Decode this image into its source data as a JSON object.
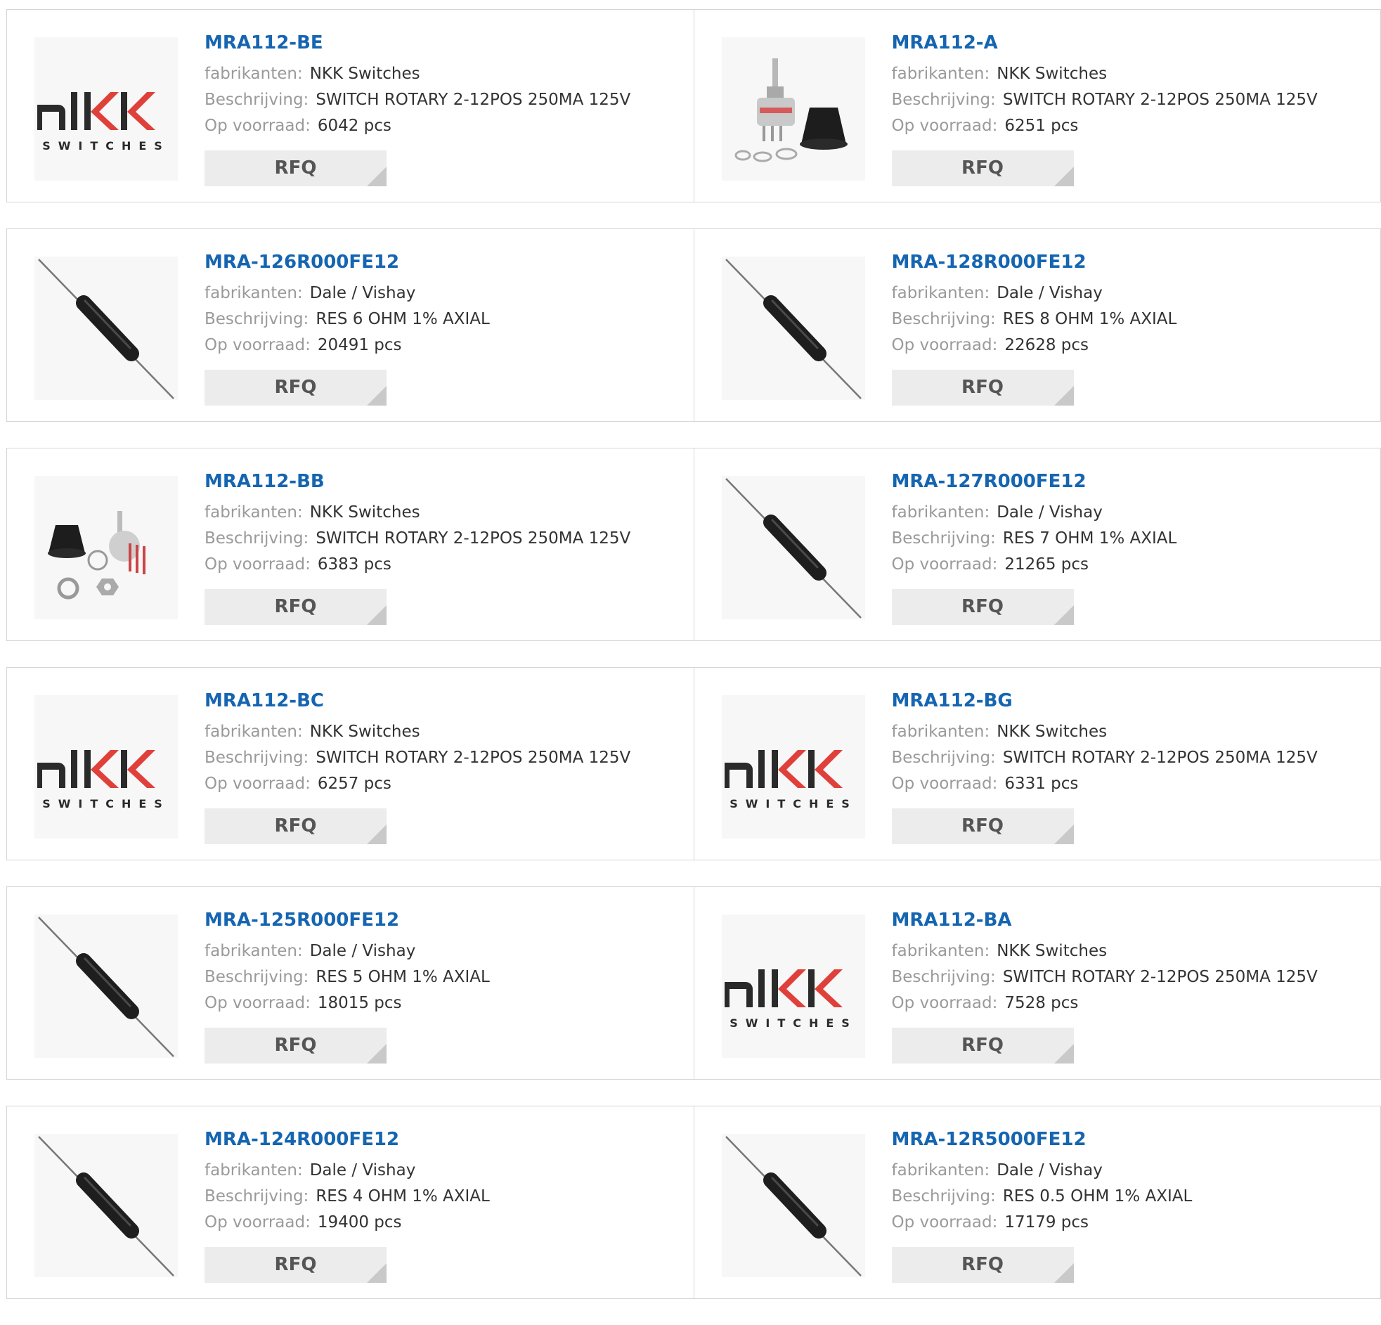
{
  "labels": {
    "manufacturer": "fabrikanten:",
    "description": "Beschrijving:",
    "stock": "Op voorraad:",
    "rfq": "RFQ"
  },
  "colors": {
    "part_link": "#1565b1",
    "label": "#9a9a9a",
    "value": "#333333",
    "button_bg": "#ececec",
    "nkk_red": "#e0403a"
  },
  "products": [
    {
      "part": "MRA112-BE",
      "manufacturer": "NKK Switches",
      "description": "SWITCH ROTARY 2-12POS 250MA 125V",
      "stock": "6042 pcs",
      "image": "nkk-switches-logo"
    },
    {
      "part": "MRA112-A",
      "manufacturer": "NKK Switches",
      "description": "SWITCH ROTARY 2-12POS 250MA 125V",
      "stock": "6251 pcs",
      "image": "rotary-switch-photo"
    },
    {
      "part": "MRA-126R000FE12",
      "manufacturer": "Dale / Vishay",
      "description": "RES 6 OHM 1% AXIAL",
      "stock": "20491 pcs",
      "image": "axial-resistor-photo"
    },
    {
      "part": "MRA-128R000FE12",
      "manufacturer": "Dale / Vishay",
      "description": "RES 8 OHM 1% AXIAL",
      "stock": "22628 pcs",
      "image": "axial-resistor-photo"
    },
    {
      "part": "MRA112-BB",
      "manufacturer": "NKK Switches",
      "description": "SWITCH ROTARY 2-12POS 250MA 125V",
      "stock": "6383 pcs",
      "image": "rotary-switch-kit-photo"
    },
    {
      "part": "MRA-127R000FE12",
      "manufacturer": "Dale / Vishay",
      "description": "RES 7 OHM 1% AXIAL",
      "stock": "21265 pcs",
      "image": "axial-resistor-photo"
    },
    {
      "part": "MRA112-BC",
      "manufacturer": "NKK Switches",
      "description": "SWITCH ROTARY 2-12POS 250MA 125V",
      "stock": "6257 pcs",
      "image": "nkk-switches-logo"
    },
    {
      "part": "MRA112-BG",
      "manufacturer": "NKK Switches",
      "description": "SWITCH ROTARY 2-12POS 250MA 125V",
      "stock": "6331 pcs",
      "image": "nkk-switches-logo"
    },
    {
      "part": "MRA-125R000FE12",
      "manufacturer": "Dale / Vishay",
      "description": "RES 5 OHM 1% AXIAL",
      "stock": "18015 pcs",
      "image": "axial-resistor-photo"
    },
    {
      "part": "MRA112-BA",
      "manufacturer": "NKK Switches",
      "description": "SWITCH ROTARY 2-12POS 250MA 125V",
      "stock": "7528 pcs",
      "image": "nkk-switches-logo"
    },
    {
      "part": "MRA-124R000FE12",
      "manufacturer": "Dale / Vishay",
      "description": "RES 4 OHM 1% AXIAL",
      "stock": "19400 pcs",
      "image": "axial-resistor-photo"
    },
    {
      "part": "MRA-12R5000FE12",
      "manufacturer": "Dale / Vishay",
      "description": "RES 0.5 OHM 1% AXIAL",
      "stock": "17179 pcs",
      "image": "axial-resistor-photo"
    }
  ]
}
